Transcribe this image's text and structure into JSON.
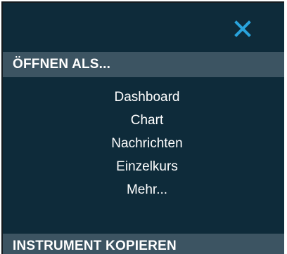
{
  "popup": {
    "close_icon": "close-icon",
    "accent_color": "#29a3dc",
    "open_as": {
      "header": "ÖFFNEN ALS...",
      "items": [
        {
          "label": "Dashboard"
        },
        {
          "label": "Chart"
        },
        {
          "label": "Nachrichten"
        },
        {
          "label": "Einzelkurs"
        },
        {
          "label": "Mehr..."
        }
      ]
    },
    "copy_instrument": {
      "header": "INSTRUMENT KOPIEREN"
    }
  }
}
